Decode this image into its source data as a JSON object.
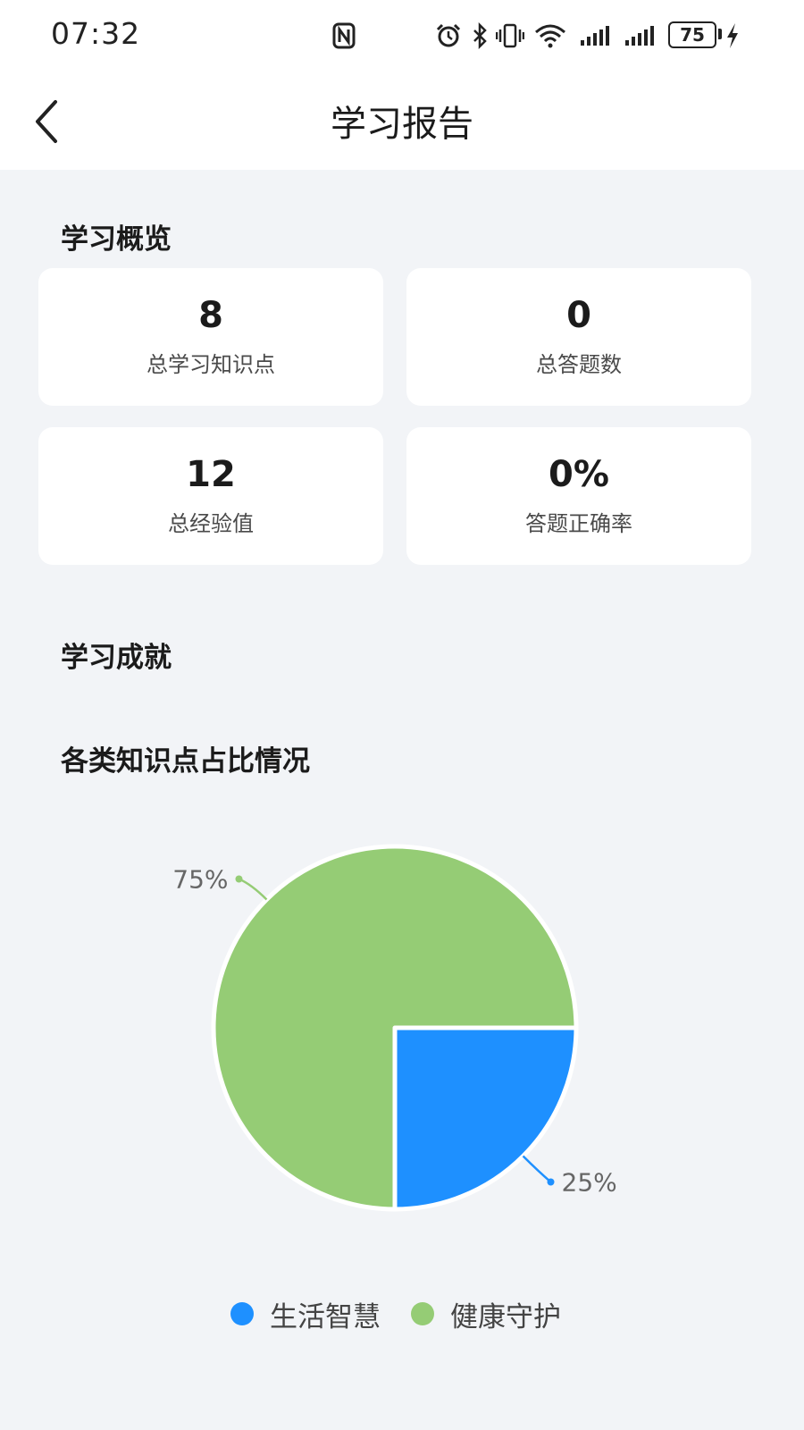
{
  "status_bar": {
    "time": "07:32",
    "battery_level": "75",
    "icons": [
      "nfc-icon",
      "alarm-icon",
      "bluetooth-icon",
      "vibrate-icon",
      "wifi-icon",
      "signal-icon",
      "signal-icon",
      "battery-icon",
      "charging-icon"
    ]
  },
  "header": {
    "title": "学习报告"
  },
  "overview": {
    "title": "学习概览",
    "cards": [
      {
        "value": "8",
        "label": "总学习知识点"
      },
      {
        "value": "0",
        "label": "总答题数"
      },
      {
        "value": "12",
        "label": "总经验值"
      },
      {
        "value": "0%",
        "label": "答题正确率"
      }
    ]
  },
  "achievements": {
    "title": "学习成就"
  },
  "distribution": {
    "title": "各类知识点占比情况"
  },
  "chart_data": {
    "type": "pie",
    "categories": [
      "生活智慧",
      "健康守护"
    ],
    "values": [
      25,
      75
    ],
    "labels": [
      "25%",
      "75%"
    ],
    "colors": [
      "#1e90ff",
      "#95cc75"
    ],
    "legend_position": "bottom"
  }
}
